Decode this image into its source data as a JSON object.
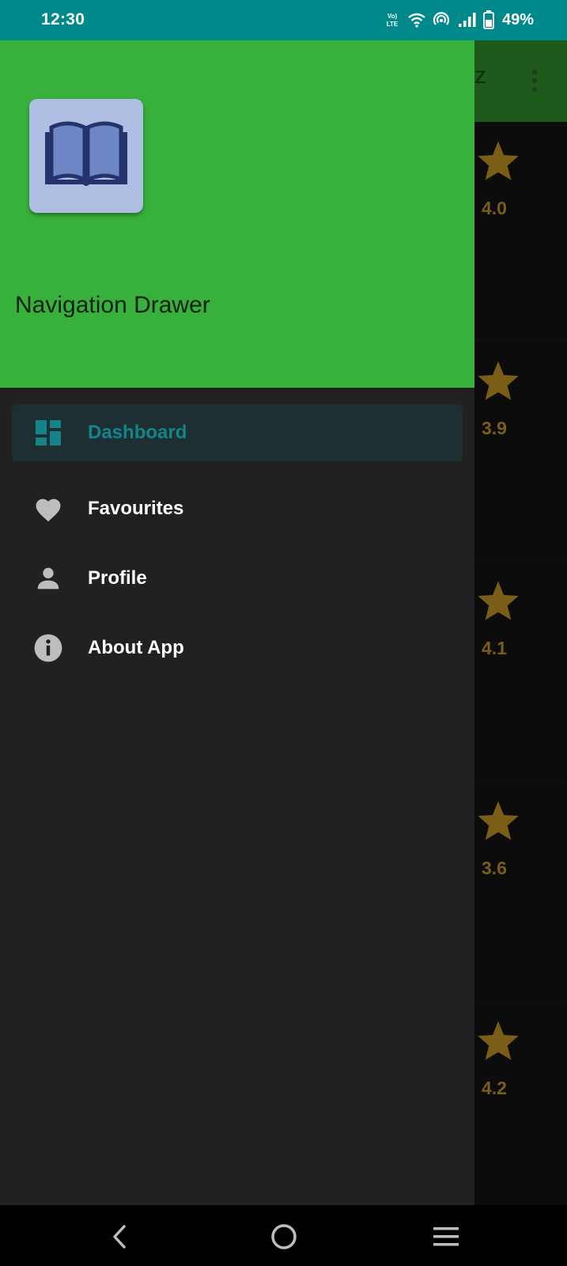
{
  "status_bar": {
    "time": "12:30",
    "battery_percent": "49%",
    "network_label": "LTE"
  },
  "background_app": {
    "title_fragment": "z",
    "ratings": [
      "4.0",
      "3.9",
      "4.1",
      "3.6",
      "4.2"
    ],
    "star_color": "#7a5d17"
  },
  "drawer": {
    "header_title": "Navigation Drawer",
    "header_color": "#38b03c",
    "logo_icon": "open-book-icon",
    "items": [
      {
        "label": "Dashboard",
        "icon": "dashboard-icon",
        "active": true
      },
      {
        "label": "Favourites",
        "icon": "heart-icon",
        "active": false
      },
      {
        "label": "Profile",
        "icon": "person-icon",
        "active": false
      },
      {
        "label": "About App",
        "icon": "info-icon",
        "active": false
      }
    ],
    "accent_color": "#13848a"
  },
  "nav_bar": {
    "back_icon": "back-icon",
    "home_icon": "home-icon",
    "recents_icon": "recents-icon"
  }
}
